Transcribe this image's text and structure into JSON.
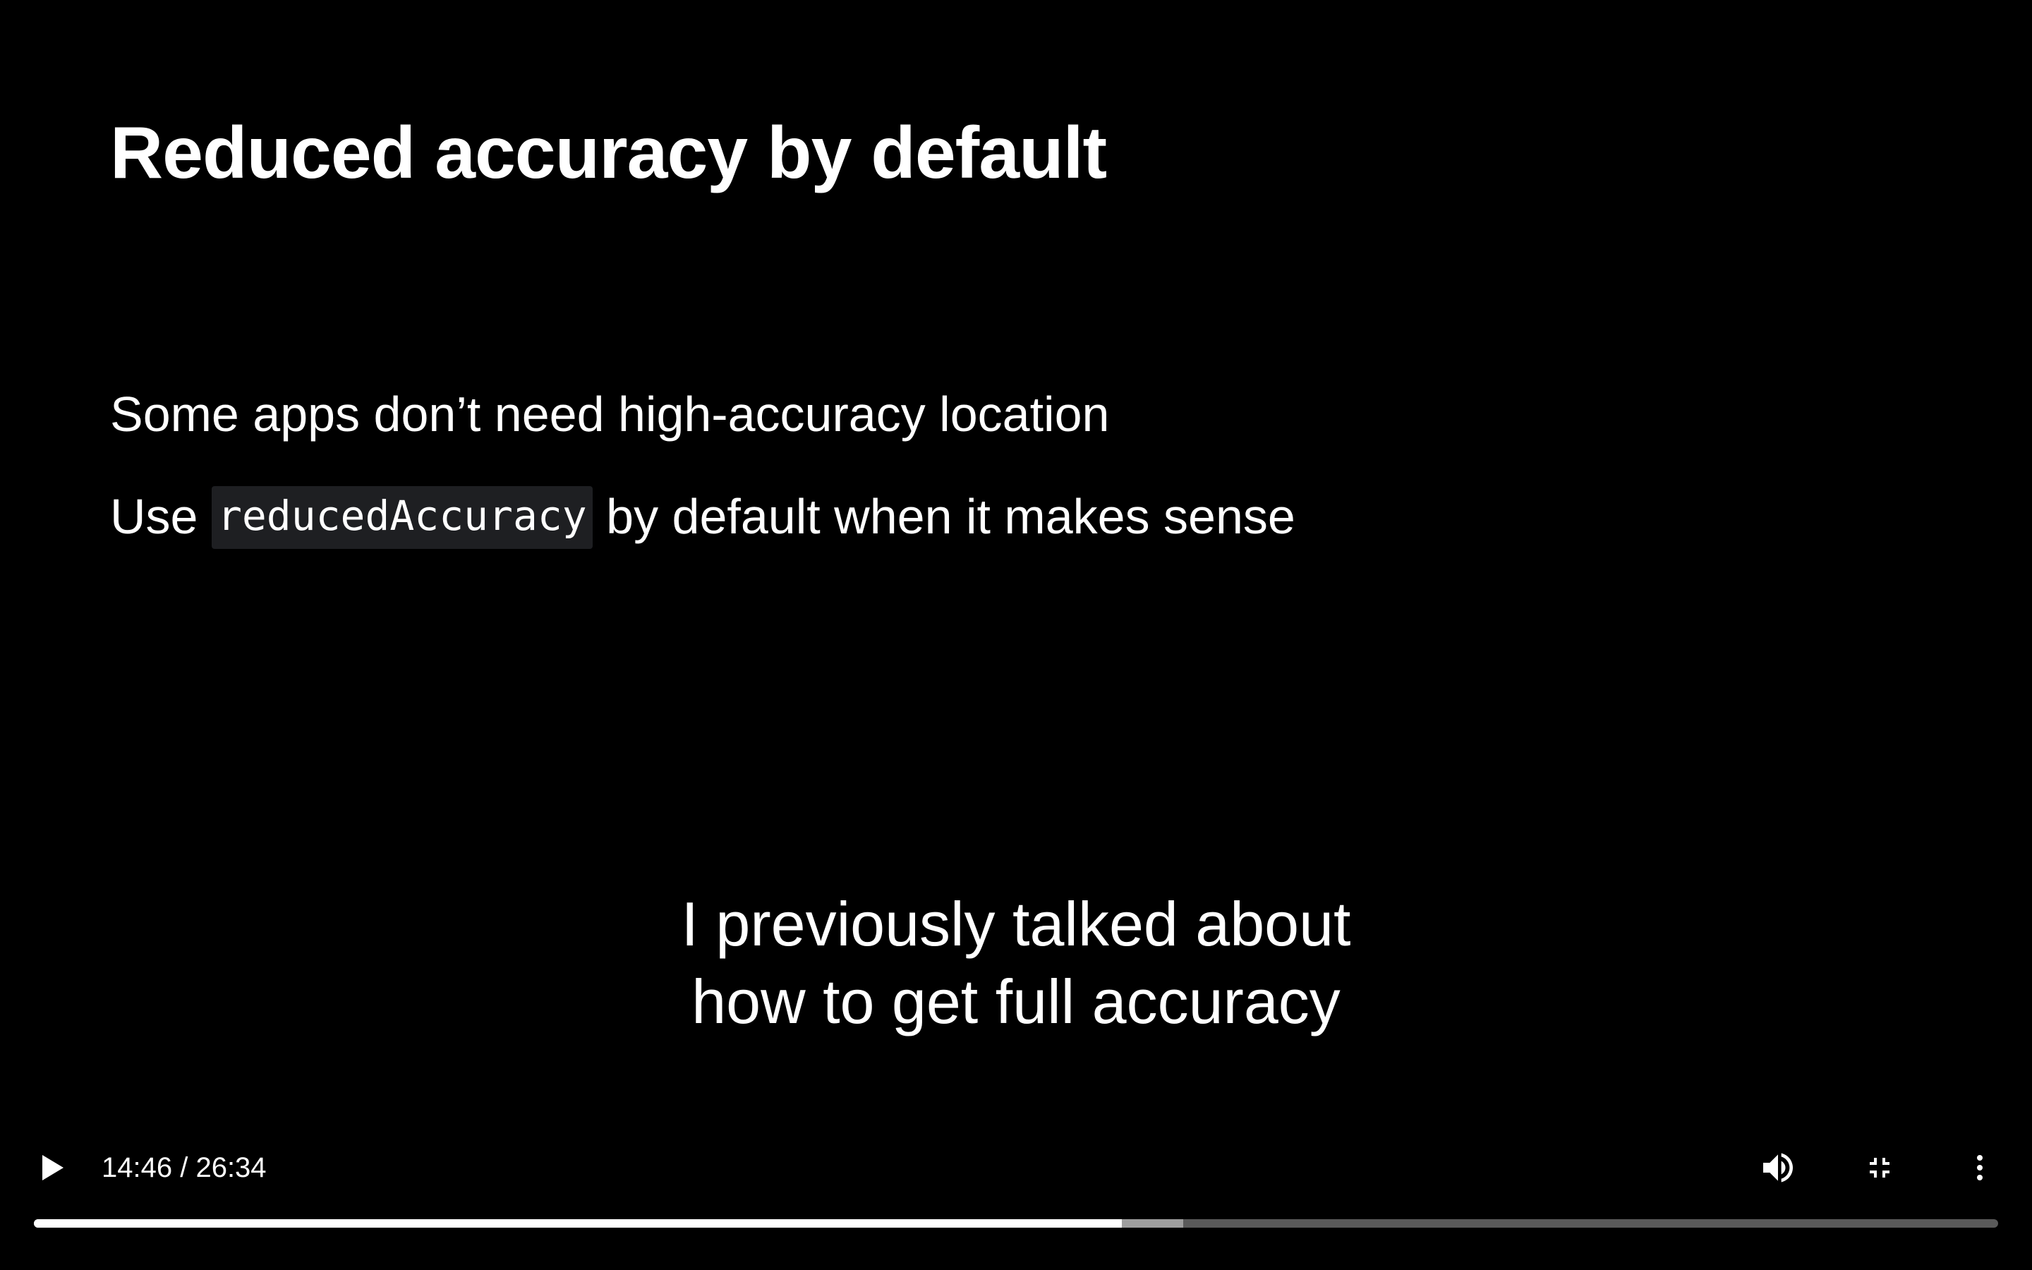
{
  "slide": {
    "title": "Reduced accuracy by default",
    "bullets": [
      {
        "text": "Some apps don’t need high-accuracy location"
      },
      {
        "prefix": "Use ",
        "code": "reducedAccuracy",
        "suffix": " by default when it makes sense"
      }
    ]
  },
  "captions": {
    "lines": [
      "I previously talked about",
      "how to get full accuracy"
    ]
  },
  "player": {
    "current_time": "14:46",
    "separator": " / ",
    "duration": "26:34",
    "progress_played_fraction": 0.554,
    "progress_buffered_fraction": 0.585,
    "icons": {
      "play": "play-icon",
      "volume": "volume-icon",
      "exit_fullscreen": "exit-fullscreen-icon",
      "more": "more-vertical-icon"
    }
  },
  "colors": {
    "background": "#000000",
    "text": "#ffffff",
    "code_background": "#1e1f22",
    "progress_track": "#5a5a5a",
    "progress_buffered": "#9e9e9e",
    "progress_played": "#ffffff"
  }
}
